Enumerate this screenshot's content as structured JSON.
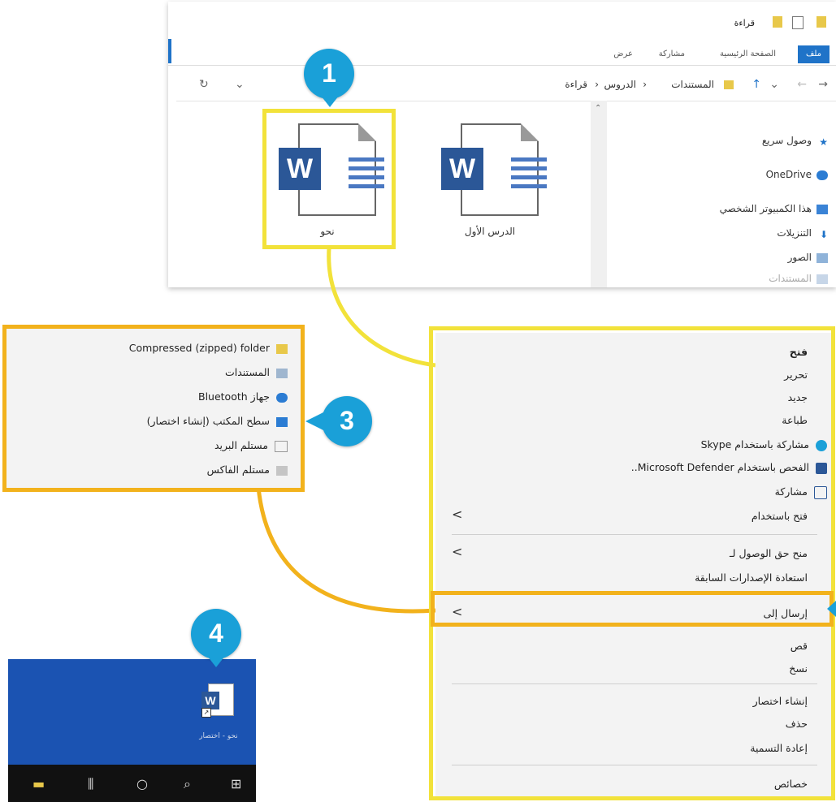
{
  "explorer": {
    "title": "قراءة",
    "tabs": [
      "ملف",
      "الصفحة الرئيسية",
      "مشاركة",
      "عرض"
    ],
    "breadcrumb": [
      "المستندات",
      "الدروس",
      "قراءة"
    ],
    "files": [
      {
        "name": "نحو"
      },
      {
        "name": "الدرس الأول"
      }
    ],
    "nav_items": [
      "وصول سريع",
      "OneDrive",
      "هذا الكمبيوتر الشخصي",
      "التنزيلات",
      "الصور",
      "المستندات"
    ]
  },
  "markers": {
    "m1": "1",
    "m3": "3",
    "m4": "4"
  },
  "context_menu": {
    "items": [
      {
        "label": "فتح"
      },
      {
        "label": "تحرير"
      },
      {
        "label": "جديد"
      },
      {
        "label": "طباعة"
      },
      {
        "label": "مشاركة باستخدام Skype"
      },
      {
        "label": "الفحص باستخدام Microsoft Defender.."
      },
      {
        "label": "مشاركة"
      },
      {
        "label": "فتح باستخدام"
      },
      {
        "label": "منح حق الوصول لـ"
      },
      {
        "label": "استعادة الإصدارات السابقة"
      },
      {
        "label": "إرسال إلى"
      },
      {
        "label": "قص"
      },
      {
        "label": "نسخ"
      },
      {
        "label": "إنشاء اختصار"
      },
      {
        "label": "حذف"
      },
      {
        "label": "إعادة التسمية"
      },
      {
        "label": "خصائص"
      }
    ]
  },
  "send_to_menu": {
    "items": [
      {
        "label": "Compressed (zipped) folder"
      },
      {
        "label": "المستندات"
      },
      {
        "label": "جهاز Bluetooth"
      },
      {
        "label": "سطح المكتب (إنشاء اختصار)"
      },
      {
        "label": "مستلم البريد"
      },
      {
        "label": "مستلم الفاكس"
      }
    ]
  },
  "desktop": {
    "shortcut_label": "نحو - اختصار"
  },
  "colors": {
    "highlight_yellow": "#f2e23a",
    "highlight_orange": "#f2b21c",
    "marker_blue": "#1aa0d8",
    "desktop_blue": "#1b53b2"
  }
}
